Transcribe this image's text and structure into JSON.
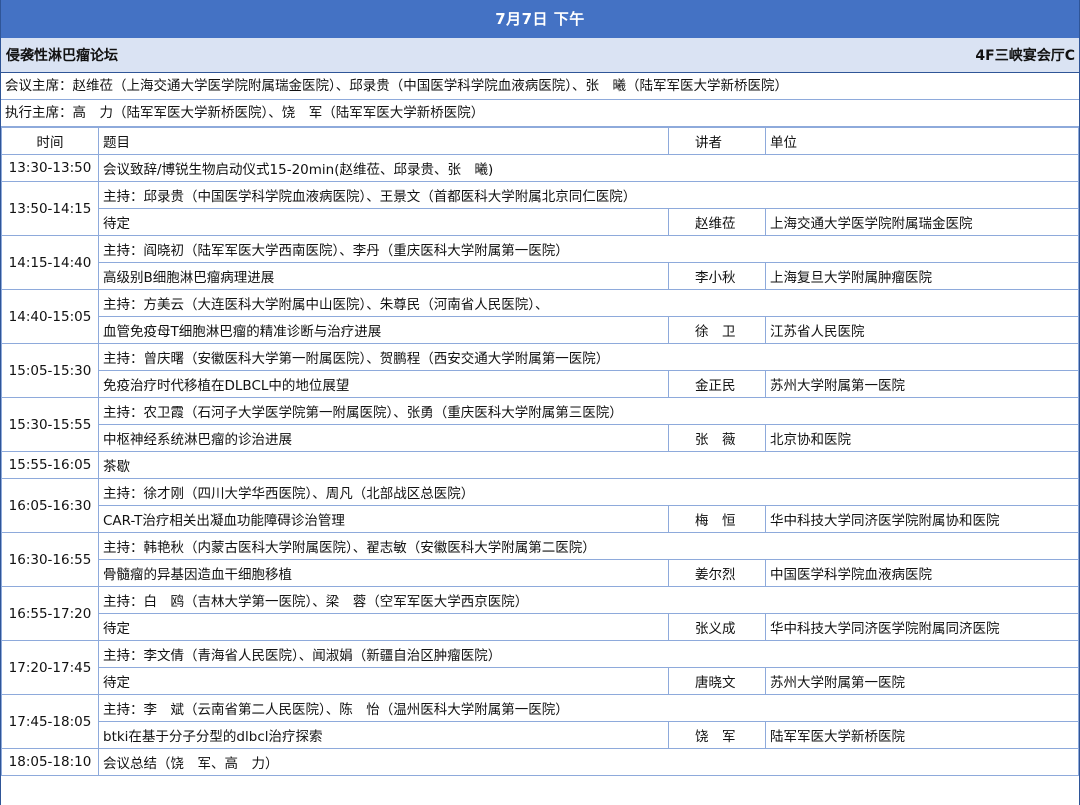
{
  "header": {
    "date": "7月7日  下午"
  },
  "forum": {
    "name": "侵袭性淋巴瘤论坛",
    "room": "4F三峡宴会厅C"
  },
  "chairs": {
    "meeting": "会议主席：赵维莅（上海交通大学医学院附属瑞金医院）、邱录贵（中国医学科学院血液病医院）、张　曦（陆军军医大学新桥医院）",
    "executive": "执行主席：高　力（陆军军医大学新桥医院）、饶　军（陆军军医大学新桥医院）"
  },
  "columns": {
    "time": "时间",
    "topic": "题目",
    "speaker": "讲者",
    "unit": "单位"
  },
  "rows": {
    "opening": {
      "time": "13:30-13:50",
      "text": "会议致辞/博锐生物启动仪式15-20min(赵维莅、邱录贵、张　曦)"
    },
    "s1": {
      "time": "13:50-14:15",
      "host": "主持：邱录贵（中国医学科学院血液病医院）、王景文（首都医科大学附属北京同仁医院）",
      "topic": "待定",
      "speaker": "赵维莅",
      "unit": "上海交通大学医学院附属瑞金医院"
    },
    "s2": {
      "time": "14:15-14:40",
      "host": "主持：阎晓初（陆军军医大学西南医院）、李丹（重庆医科大学附属第一医院）",
      "topic": "高级别B细胞淋巴瘤病理进展",
      "speaker": "李小秋",
      "unit": "上海复旦大学附属肿瘤医院"
    },
    "s3": {
      "time": "14:40-15:05",
      "host": "主持：方美云（大连医科大学附属中山医院）、朱尊民（河南省人民医院）、",
      "topic": "血管免疫母T细胞淋巴瘤的精准诊断与治疗进展",
      "speaker": "徐　卫",
      "unit": "江苏省人民医院"
    },
    "s4": {
      "time": "15:05-15:30",
      "host": "主持：曾庆曙（安徽医科大学第一附属医院）、贺鹏程（西安交通大学附属第一医院）",
      "topic": "免疫治疗时代移植在DLBCL中的地位展望",
      "speaker": "金正民",
      "unit": "苏州大学附属第一医院"
    },
    "s5": {
      "time": "15:30-15:55",
      "host": "主持：农卫霞（石河子大学医学院第一附属医院）、张勇（重庆医科大学附属第三医院）",
      "topic": "中枢神经系统淋巴瘤的诊治进展",
      "speaker": "张　薇",
      "unit": "北京协和医院"
    },
    "tea": {
      "time": "15:55-16:05",
      "text": "茶歇"
    },
    "s6": {
      "time": "16:05-16:30",
      "host": "主持：徐才刚（四川大学华西医院）、周凡（北部战区总医院）",
      "topic": "CAR-T治疗相关出凝血功能障碍诊治管理",
      "speaker": "梅　恒",
      "unit": "华中科技大学同济医学院附属协和医院"
    },
    "s7": {
      "time": "16:30-16:55",
      "host": "主持：韩艳秋（内蒙古医科大学附属医院）、翟志敏（安徽医科大学附属第二医院）",
      "topic": "骨髓瘤的异基因造血干细胞移植",
      "speaker": "姜尔烈",
      "unit": "中国医学科学院血液病医院"
    },
    "s8": {
      "time": "16:55-17:20",
      "host": "主持：白　鸥（吉林大学第一医院）、梁　蓉（空军军医大学西京医院）",
      "topic": "待定",
      "speaker": "张义成",
      "unit": "华中科技大学同济医学院附属同济医院"
    },
    "s9": {
      "time": "17:20-17:45",
      "host": "主持：李文倩（青海省人民医院）、闻淑娟（新疆自治区肿瘤医院）",
      "topic": "待定",
      "speaker": "唐晓文",
      "unit": "苏州大学附属第一医院"
    },
    "s10": {
      "time": "17:45-18:05",
      "host": "主持：李　斌（云南省第二人民医院）、陈　怡（温州医科大学附属第一医院）",
      "topic": "btki在基于分子分型的dlbcl治疗探索",
      "speaker": "饶　军",
      "unit": "陆军军医大学新桥医院"
    },
    "closing": {
      "time": "18:05-18:10",
      "text": "会议总结（饶　军、高　力）"
    }
  }
}
